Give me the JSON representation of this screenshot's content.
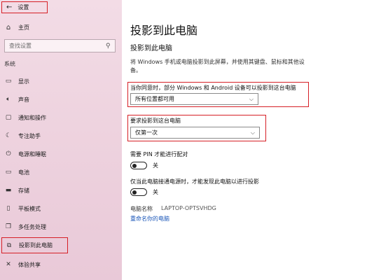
{
  "window": {
    "back_glyph": "←",
    "title": "设置"
  },
  "sidebar": {
    "home": {
      "label": "主页",
      "icon": "home-icon"
    },
    "search": {
      "placeholder": "查找设置"
    },
    "section": "系统",
    "items": [
      {
        "label": "显示",
        "icon": "display-icon"
      },
      {
        "label": "声音",
        "icon": "sound-icon"
      },
      {
        "label": "通知和操作",
        "icon": "notifications-icon"
      },
      {
        "label": "专注助手",
        "icon": "focus-assist-icon"
      },
      {
        "label": "电源和睡眠",
        "icon": "power-icon"
      },
      {
        "label": "电池",
        "icon": "battery-icon"
      },
      {
        "label": "存储",
        "icon": "storage-icon"
      },
      {
        "label": "平板模式",
        "icon": "tablet-mode-icon"
      },
      {
        "label": "多任务处理",
        "icon": "multitasking-icon"
      },
      {
        "label": "投影到此电脑",
        "icon": "project-icon",
        "selected": true
      },
      {
        "label": "体验共享",
        "icon": "shared-experiences-icon"
      }
    ]
  },
  "main": {
    "title": "投影到此电脑",
    "subtitle": "投影到此电脑",
    "description": "将 Windows 手机或电脑投影到此屏幕，并使用其键盘、鼠标和其他设备。",
    "availability": {
      "label": "当你同意时，部分 Windows 和 Android 设备可以投影到这台电脑",
      "value": "所有位置都可用"
    },
    "ask_to_project": {
      "label": "要求投影到这台电脑",
      "value": "仅第一次"
    },
    "require_pin": {
      "label": "需要 PIN 才能进行配对",
      "state": "关"
    },
    "only_when_plugged": {
      "label": "仅当此电脑接通电源时，才能发现此电脑以进行投影",
      "state": "关"
    },
    "pc_name": {
      "key": "电脑名称",
      "value": "LAPTOP-OPTSVHDG"
    },
    "rename_link": "重命名你的电脑"
  },
  "colors": {
    "highlight_border": "#d61f26",
    "link": "#1a56b8",
    "sidebar_tint": "#efd6e1"
  }
}
